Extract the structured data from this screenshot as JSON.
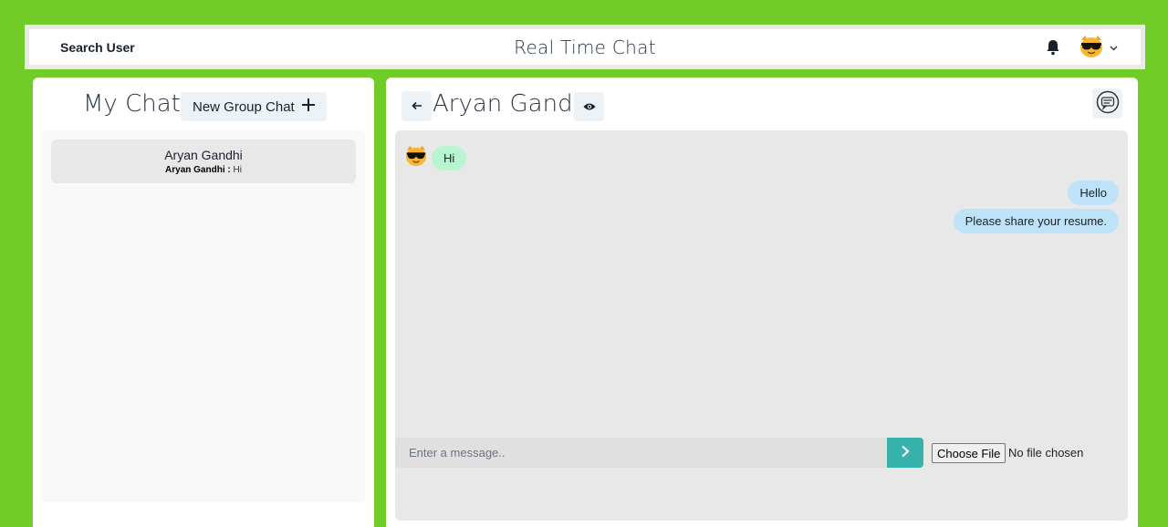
{
  "header": {
    "search_label": "Search User",
    "app_title": "Real Time Chat"
  },
  "sidebar": {
    "title": "My Chats",
    "new_group_label": "New Group Chat",
    "chats": [
      {
        "name": "Aryan Gandhi",
        "preview_sender": "Aryan Gandhi :",
        "preview_text": "Hi"
      }
    ]
  },
  "chat": {
    "title": "Aryan Gandhi",
    "messages": [
      {
        "side": "in",
        "text": "Hi"
      },
      {
        "side": "out",
        "text": "Hello"
      },
      {
        "side": "out",
        "text": "Please share your resume."
      }
    ],
    "input_placeholder": "Enter a message..",
    "file_button": "Choose File",
    "file_status": "No file chosen"
  },
  "colors": {
    "background": "#72cc27",
    "incoming_bubble": "#b9f5d0",
    "outgoing_bubble": "#bee3f8",
    "send_button": "#38b2ac"
  }
}
